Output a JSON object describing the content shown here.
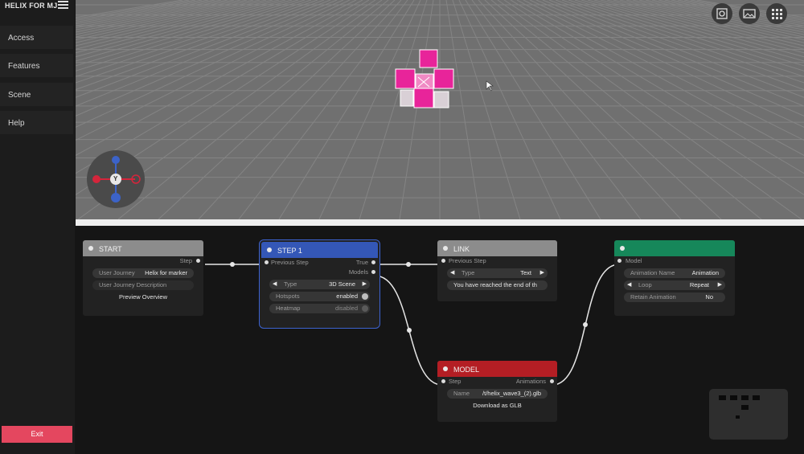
{
  "app": {
    "brand": "HELIX FOR MJ"
  },
  "sidebar": {
    "items": [
      {
        "label": "Access"
      },
      {
        "label": "Features"
      },
      {
        "label": "Scene"
      },
      {
        "label": "Help"
      }
    ],
    "exit_label": "Exit"
  },
  "viewport": {
    "gizmo_center_label": "Y",
    "tools": [
      "focus-icon",
      "image-icon",
      "grid-menu-icon"
    ],
    "object_color": "#e8249a",
    "background_color": "#707070"
  },
  "nodes": {
    "start": {
      "title": "START",
      "output_port": "Step",
      "journey_label": "User Journey",
      "journey_value": "Helix for marker",
      "description_placeholder": "User Journey Description",
      "preview_label": "Preview Overview",
      "color": "#8c8c8c"
    },
    "step": {
      "title": "STEP 1",
      "input_port": "Previous Step",
      "output_true": "True",
      "output_models": "Models",
      "type_label": "Type",
      "type_value": "3D Scene",
      "hotspots_label": "Hotspots",
      "hotspots_value": "enabled",
      "heatmap_label": "Heatmap",
      "heatmap_value": "disabled",
      "color": "#3457b7"
    },
    "link": {
      "title": "LINK",
      "input_port": "Previous Step",
      "type_label": "Type",
      "type_value": "Text",
      "text_value": "You have reached the end of th",
      "color": "#8c8c8c"
    },
    "model": {
      "title": "MODEL",
      "input_port": "Step",
      "output_port": "Animations",
      "name_label": "Name",
      "name_value": "/t/helix_wave3_(2).glb",
      "download_label": "Download as GLB",
      "color": "#b41e24"
    },
    "animation": {
      "title": "",
      "input_port": "Model",
      "anim_name_label": "Animation Name",
      "anim_name_value": "Animation",
      "loop_label": "Loop",
      "loop_value": "Repeat",
      "retain_label": "Retain Animation",
      "retain_value": "No",
      "color": "#16875a"
    }
  }
}
